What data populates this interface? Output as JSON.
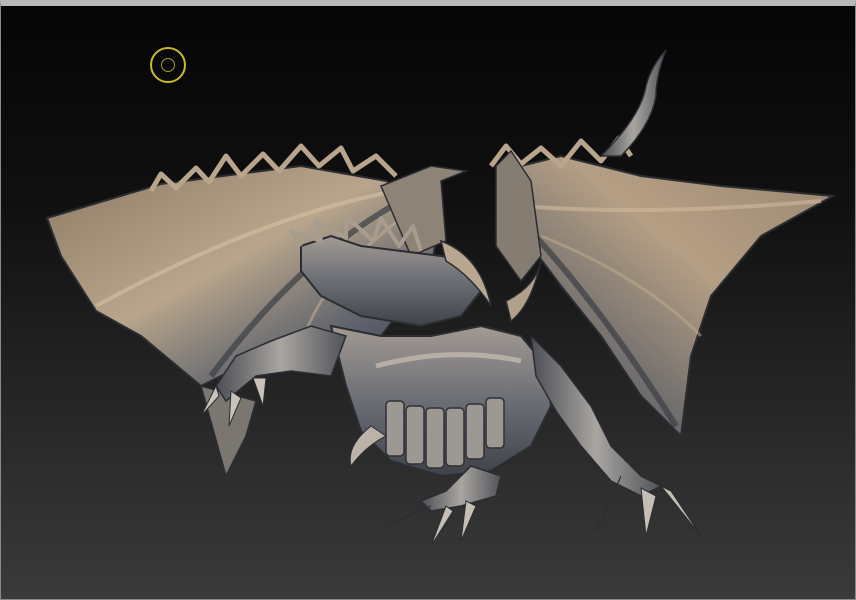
{
  "viewport": {
    "model_name": "",
    "colors": {
      "background_top": "#050505",
      "background_bottom": "#3a3a3a",
      "brush_cursor": "#c9b82a",
      "model_shadow": "#3d3f45",
      "model_mid": "#7a7d85",
      "model_highlight": "#c9a77a"
    },
    "brush_cursor_icon": "brush-circle-icon",
    "model": "dragon-sculpt"
  }
}
